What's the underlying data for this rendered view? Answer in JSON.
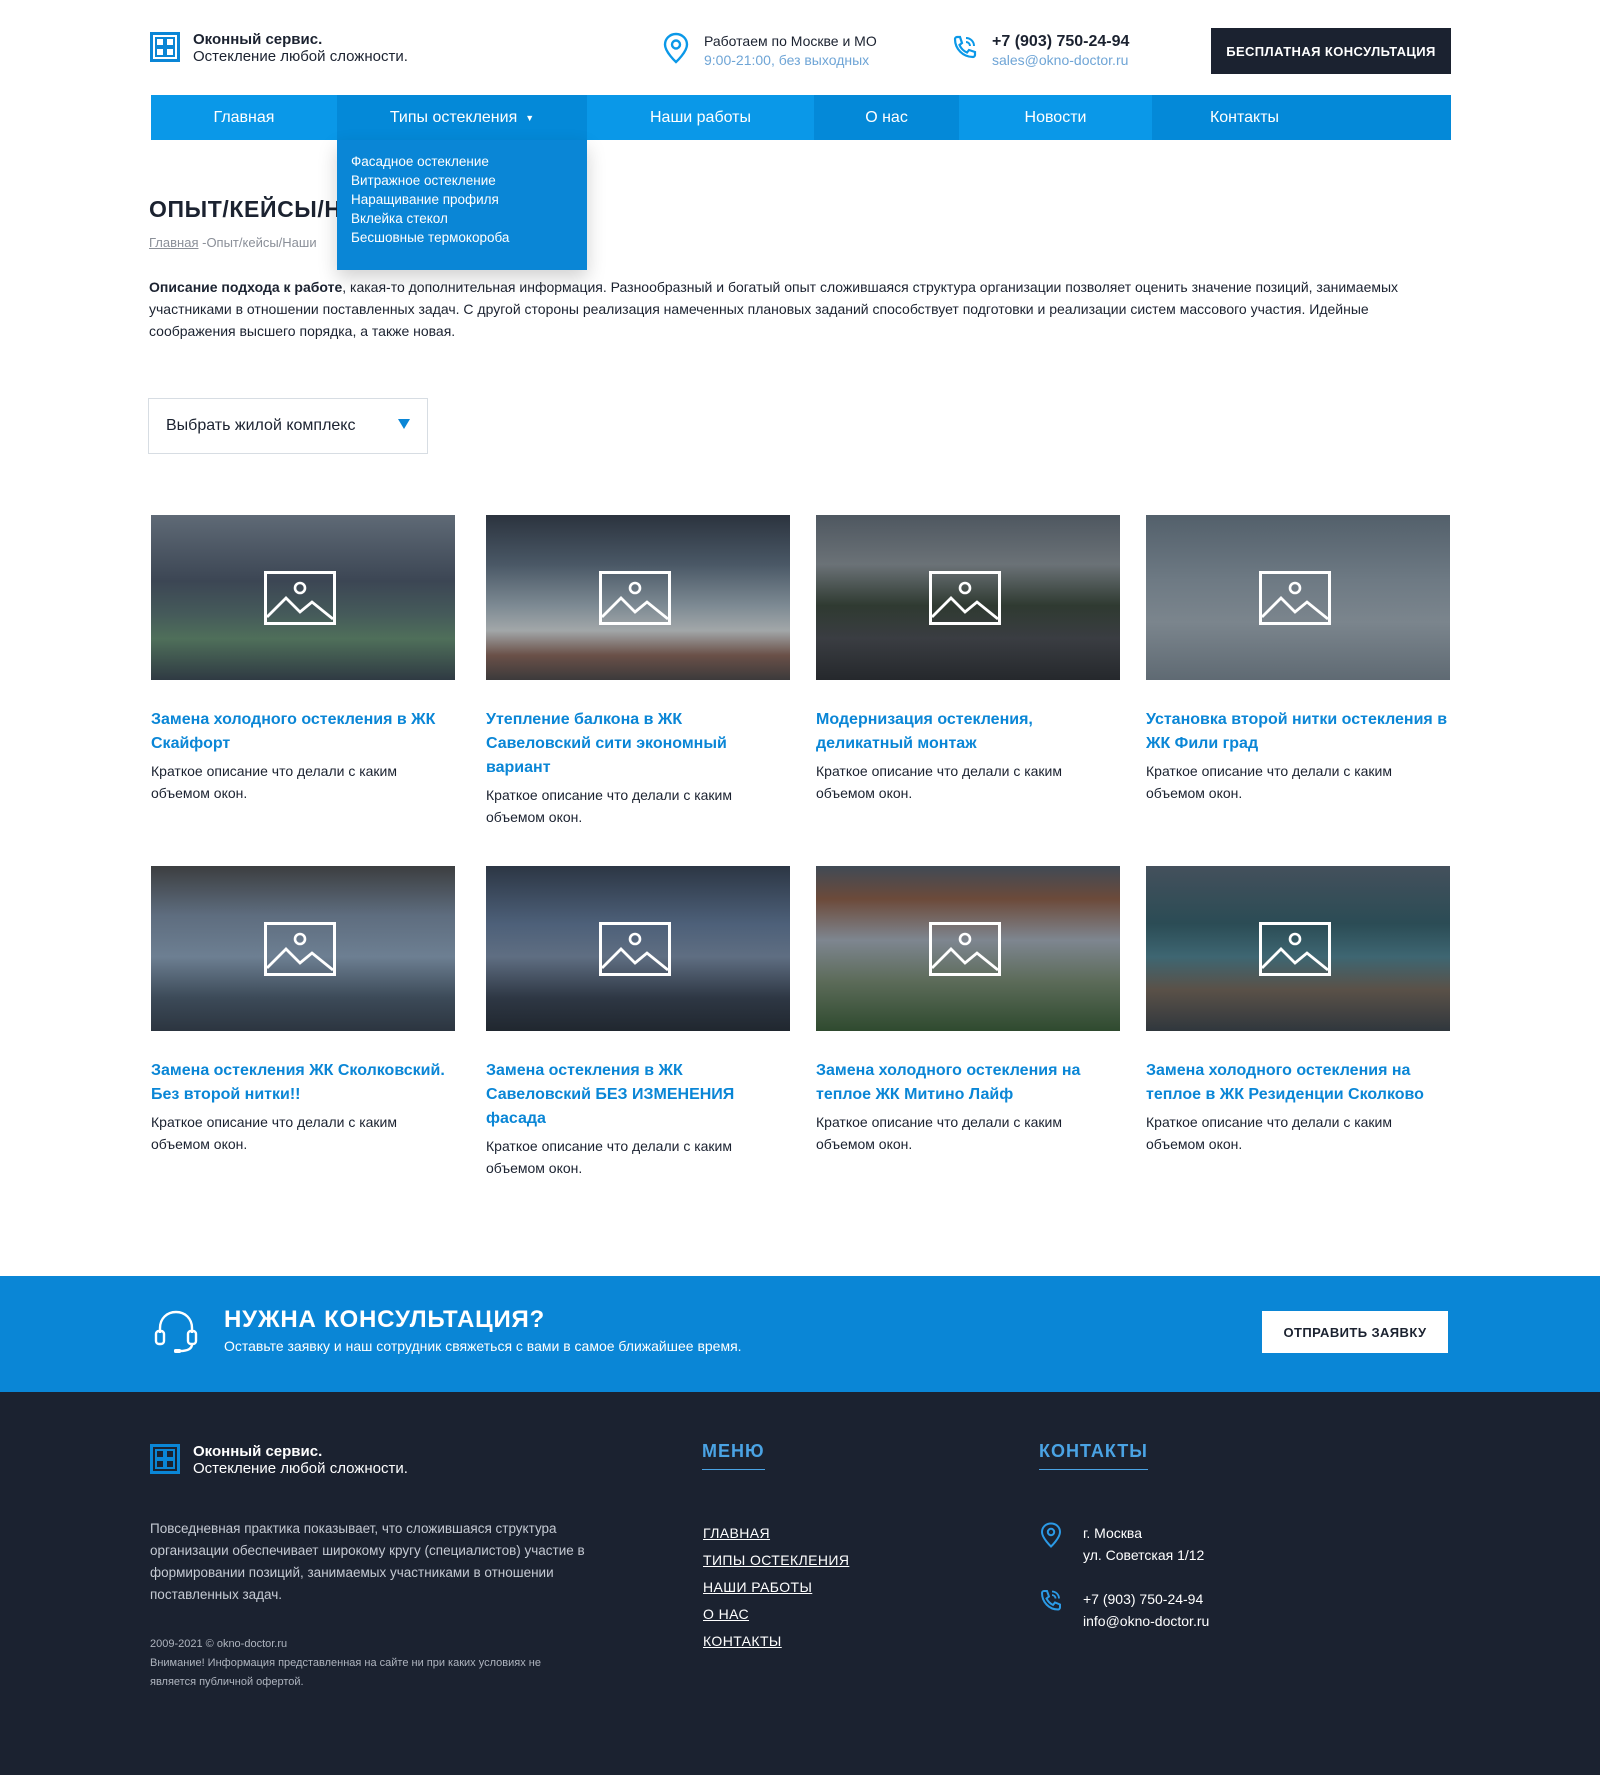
{
  "header": {
    "logo_name": "Оконный сервис.",
    "logo_tagline": "Остекление любой сложности.",
    "location_main": "Работаем по Москве и МО",
    "location_sub": "9:00-21:00, без выходных",
    "phone": "+7 (903) 750-24-94",
    "email": "sales@okno-doctor.ru",
    "consult_button": "БЕСПЛАТНАЯ КОНСУЛЬТАЦИЯ"
  },
  "nav": {
    "items": [
      {
        "label": "Главная"
      },
      {
        "label": "Типы остекления"
      },
      {
        "label": "Наши работы"
      },
      {
        "label": "О нас"
      },
      {
        "label": "Новости"
      },
      {
        "label": "Контакты"
      }
    ],
    "dropdown": [
      "Фасадное остекление",
      "Витражное остекление",
      "Наращивание профиля",
      "Вклейка стекол",
      "Бесшовные термокороба"
    ]
  },
  "page": {
    "title": "ОПЫТ/КЕЙСЫ/Н",
    "breadcrumb_home": "Главная",
    "breadcrumb_current": "-Опыт/кейсы/Наши",
    "intro_bold": "Описание подхода к работе",
    "intro_text": ", какая-то дополнительная информация. Разнообразный и богатый опыт сложившаяся структура организации позволяет оценить значение позиций, занимаемых участниками в отношении поставленных задач. С другой стороны реализация намеченных плановых заданий способствует подготовки и реализации систем массового участия. Идейные соображения высшего порядка, а также новая.",
    "select_label": "Выбрать жилой комплекс"
  },
  "cards": [
    {
      "title": "Замена холодного остекления в ЖК Скайфорт",
      "desc": "Краткое описание что делали с каким объемом окон."
    },
    {
      "title": "Утепление балкона в ЖК Савеловский сити экономный вариант",
      "desc": "Краткое описание что делали с каким объемом окон."
    },
    {
      "title": "Модернизация остекления, деликатный монтаж",
      "desc": "Краткое описание что делали с каким объемом окон."
    },
    {
      "title": "Установка второй нитки остекления в ЖК Фили град",
      "desc": "Краткое описание что делали с каким объемом окон."
    },
    {
      "title": "Замена остекления ЖК Сколковский. Без второй нитки!!",
      "desc": "Краткое описание что делали с каким объемом окон."
    },
    {
      "title": "Замена остекления в ЖК Савеловский БЕЗ ИЗМЕНЕНИЯ фасада",
      "desc": "Краткое описание что делали с каким объемом окон."
    },
    {
      "title": "Замена холодного остекления на теплое ЖК Митино Лайф",
      "desc": "Краткое описание что делали с каким объемом окон."
    },
    {
      "title": "Замена холодного остекления на теплое в ЖК Резиденции Сколково",
      "desc": "Краткое описание что делали с каким объемом окон."
    }
  ],
  "cta": {
    "title": "НУЖНА КОНСУЛЬТАЦИЯ?",
    "subtitle": "Оставьте заявку и наш сотрудник свяжеться с вами в самое ближайшее время.",
    "button": "ОТПРАВИТЬ ЗАЯВКУ"
  },
  "footer": {
    "logo_name": "Оконный сервис.",
    "logo_tagline": "Остекление любой сложности.",
    "about": "Повседневная практика показывает, что сложившаяся структура организации обеспечивает широкому кругу (специалистов) участие в формировании позиций, занимаемых участниками в отношении поставленных задач.",
    "copyright": "2009-2021  © okno-doctor.ru",
    "disclaimer": "Внимание! Информация представленная на сайте ни при каких условиях не является публичной офертой.",
    "menu_heading": "МЕНЮ",
    "menu": [
      "ГЛАВНАЯ",
      "ТИПЫ ОСТЕКЛЕНИЯ",
      "НАШИ РАБОТЫ",
      "О НАС",
      "КОНТАКТЫ"
    ],
    "contacts_heading": "КОНТАКТЫ",
    "city": "г. Москва",
    "street": "ул. Советская 1/12",
    "phone": "+7 (903) 750-24-94",
    "email": "info@okno-doctor.ru"
  },
  "colors": {
    "accent": "#0a98e8",
    "accent_dark": "#0a86d6",
    "navy": "#1b2230",
    "link": "#0a86d6"
  },
  "icons": [
    "window-logo-icon",
    "location-pin-icon",
    "phone-icon",
    "dropdown-caret-icon",
    "image-placeholder-icon",
    "headset-icon"
  ]
}
